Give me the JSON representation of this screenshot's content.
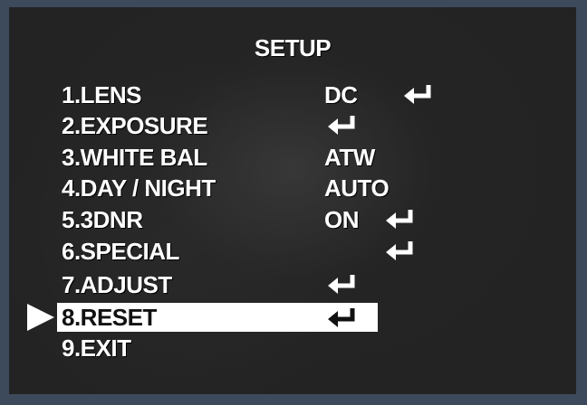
{
  "menu": {
    "title": "SETUP",
    "items": [
      {
        "label": "1.LENS",
        "value": "DC",
        "has_enter": true
      },
      {
        "label": "2.EXPOSURE",
        "value": "",
        "has_enter": true
      },
      {
        "label": "3.WHITE BAL",
        "value": "ATW",
        "has_enter": false
      },
      {
        "label": "4.DAY / NIGHT",
        "value": "AUTO",
        "has_enter": false
      },
      {
        "label": "5.3DNR",
        "value": "ON",
        "has_enter": true
      },
      {
        "label": "6.SPECIAL",
        "value": "",
        "has_enter": true
      },
      {
        "label": "7.ADJUST",
        "value": "",
        "has_enter": true
      },
      {
        "label": "8.RESET",
        "value": "",
        "has_enter": true,
        "selected": true
      },
      {
        "label": "9.EXIT",
        "value": "",
        "has_enter": false
      }
    ]
  },
  "icons": {
    "enter": "enter-return-icon",
    "cursor": "selection-arrow-icon"
  },
  "colors": {
    "text": "#ffffff",
    "highlight": "#ffffff",
    "highlight_text": "#111111",
    "background": "#232323",
    "frame": "#3d4a5c"
  }
}
